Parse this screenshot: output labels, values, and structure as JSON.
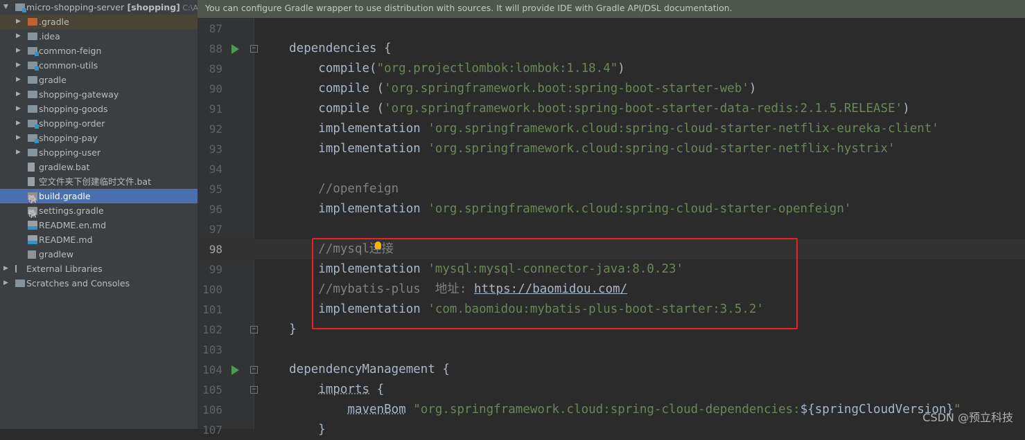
{
  "project_tree": {
    "items": [
      {
        "label": "micro-shopping-server",
        "bold": "[shopping]",
        "path": "C:\\AW",
        "icon": "module-folder-icon",
        "level": 0,
        "expanded": true
      },
      {
        "label": ".gradle",
        "icon": "excluded-folder-icon",
        "level": 1,
        "highlight": true
      },
      {
        "label": ".idea",
        "icon": "folder-icon",
        "level": 1
      },
      {
        "label": "common-feign",
        "icon": "module-folder-icon",
        "level": 1
      },
      {
        "label": "common-utils",
        "icon": "module-folder-icon",
        "level": 1
      },
      {
        "label": "gradle",
        "icon": "folder-icon",
        "level": 1
      },
      {
        "label": "shopping-gateway",
        "icon": "folder-icon",
        "level": 1
      },
      {
        "label": "shopping-goods",
        "icon": "folder-icon",
        "level": 1
      },
      {
        "label": "shopping-order",
        "icon": "module-folder-icon",
        "level": 1
      },
      {
        "label": "shopping-pay",
        "icon": "module-folder-icon",
        "level": 1
      },
      {
        "label": "shopping-user",
        "icon": "folder-icon",
        "level": 1
      },
      {
        "label": "gradlew.bat",
        "icon": "text-file-icon",
        "level": 2
      },
      {
        "label": "空文件夹下创建临时文件.bat",
        "icon": "text-file-icon",
        "level": 2
      },
      {
        "label": "build.gradle",
        "icon": "gradle-elephant-icon",
        "level": 2,
        "selected": true
      },
      {
        "label": "settings.gradle",
        "icon": "gradle-elephant-icon",
        "level": 2
      },
      {
        "label": "README.en.md",
        "icon": "markdown-file-icon",
        "level": 2
      },
      {
        "label": "README.md",
        "icon": "markdown-file-icon",
        "level": 2
      },
      {
        "label": "gradlew",
        "icon": "shell-script-icon",
        "level": 2
      },
      {
        "label": "External Libraries",
        "icon": "libraries-icon",
        "level": 0
      },
      {
        "label": "Scratches and Consoles",
        "icon": "scratches-icon",
        "level": 0
      }
    ]
  },
  "banner": {
    "text": "You can configure Gradle wrapper to use distribution with sources. It will provide IDE with Gradle API/DSL documentation."
  },
  "editor": {
    "current_line": 98,
    "lines": [
      {
        "n": 87,
        "t": []
      },
      {
        "n": 88,
        "run": true,
        "fold": true,
        "t": [
          [
            "p",
            "    dependencies {"
          ]
        ]
      },
      {
        "n": 89,
        "t": [
          [
            "p",
            "        compile("
          ],
          [
            "s",
            "\"org.projectlombok:lombok:1.18.4\""
          ],
          [
            "p",
            ")"
          ]
        ]
      },
      {
        "n": 90,
        "t": [
          [
            "p",
            "        compile ("
          ],
          [
            "s",
            "'org.springframework.boot:spring-boot-starter-web'"
          ],
          [
            "p",
            ")"
          ]
        ]
      },
      {
        "n": 91,
        "t": [
          [
            "p",
            "        compile ("
          ],
          [
            "s",
            "'org.springframework.boot:spring-boot-starter-data-redis:2.1.5.RELEASE'"
          ],
          [
            "p",
            ")"
          ]
        ]
      },
      {
        "n": 92,
        "t": [
          [
            "p",
            "        implementation "
          ],
          [
            "s",
            "'org.springframework.cloud:spring-cloud-starter-netflix-eureka-client'"
          ]
        ]
      },
      {
        "n": 93,
        "t": [
          [
            "p",
            "        implementation "
          ],
          [
            "s",
            "'org.springframework.cloud:spring-cloud-starter-netflix-hystrix'"
          ]
        ]
      },
      {
        "n": 94,
        "t": []
      },
      {
        "n": 95,
        "t": [
          [
            "c",
            "        //openfeign"
          ]
        ]
      },
      {
        "n": 96,
        "t": [
          [
            "p",
            "        implementation "
          ],
          [
            "s",
            "'org.springframework.cloud:spring-cloud-starter-openfeign'"
          ]
        ]
      },
      {
        "n": 97,
        "t": []
      },
      {
        "n": 98,
        "t": [
          [
            "c",
            "        //mysql连接"
          ]
        ]
      },
      {
        "n": 99,
        "t": [
          [
            "p",
            "        implementation "
          ],
          [
            "s",
            "'mysql:mysql-connector-java:8.0.23'"
          ]
        ]
      },
      {
        "n": 100,
        "t": [
          [
            "c",
            "        //mybatis-plus  地址: "
          ],
          [
            "u",
            "https://baomidou.com/"
          ]
        ]
      },
      {
        "n": 101,
        "t": [
          [
            "p",
            "        implementation "
          ],
          [
            "s",
            "'com.baomidou:mybatis-plus-boot-starter:3.5.2'"
          ]
        ]
      },
      {
        "n": 102,
        "fold": true,
        "t": [
          [
            "p",
            "    }"
          ]
        ]
      },
      {
        "n": 103,
        "t": []
      },
      {
        "n": 104,
        "run": true,
        "fold": true,
        "t": [
          [
            "p",
            "    dependencyManagement {"
          ]
        ]
      },
      {
        "n": 105,
        "fold": true,
        "t": [
          [
            "p",
            "        "
          ],
          [
            "d",
            "imports"
          ],
          [
            "p",
            " {"
          ]
        ]
      },
      {
        "n": 106,
        "t": [
          [
            "p",
            "            "
          ],
          [
            "d",
            "mavenBom"
          ],
          [
            "p",
            " "
          ],
          [
            "s",
            "\"org.springframework.cloud:spring-cloud-dependencies:"
          ],
          [
            "p",
            "${springCloudVersion}"
          ],
          [
            "s",
            "\""
          ]
        ]
      },
      {
        "n": 107,
        "t": [
          [
            "p",
            "        }"
          ]
        ]
      }
    ]
  },
  "watermark": "CSDN @预立科技",
  "colors": {
    "background": "#2b2b2b",
    "sidebar": "#3c3f41",
    "selection": "#4b6eaf",
    "string": "#6a8759",
    "comment": "#808080",
    "keyword_text": "#a9b7c6",
    "annotation_box": "#f02020",
    "run_icon": "#499c54"
  }
}
